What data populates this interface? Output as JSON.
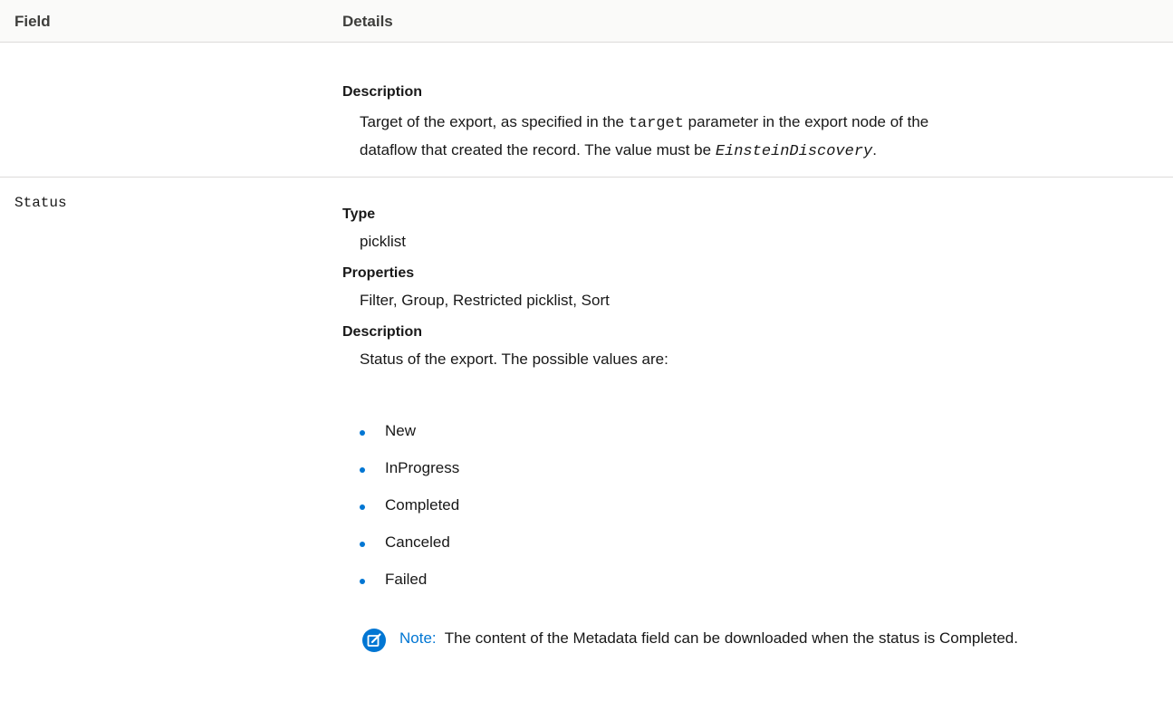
{
  "header": {
    "field_label": "Field",
    "details_label": "Details"
  },
  "rows": [
    {
      "description": {
        "label": "Description",
        "text_before": "Target of the export, as specified in the ",
        "code": "target",
        "text_after": " parameter in the export node of the",
        "line2_before": "dataflow that created the record. The value must be ",
        "code2": "EinsteinDiscovery",
        "line2_after": "."
      }
    },
    {
      "field_name": "Status",
      "type": {
        "label": "Type",
        "value": "picklist"
      },
      "properties": {
        "label": "Properties",
        "value": "Filter, Group, Restricted picklist, Sort"
      },
      "description": {
        "label": "Description",
        "intro": "Status of the export. The possible values are:",
        "values": [
          "New",
          "InProgress",
          "Completed",
          "Canceled",
          "Failed"
        ]
      },
      "note": {
        "icon": "note-edit-icon",
        "label": "Note:",
        "text": "The content of the Metadata field can be downloaded when the status is Completed."
      }
    }
  ],
  "colors": {
    "accent": "#0176d3",
    "header_bg": "#fafaf9",
    "divider": "#dddbda"
  }
}
